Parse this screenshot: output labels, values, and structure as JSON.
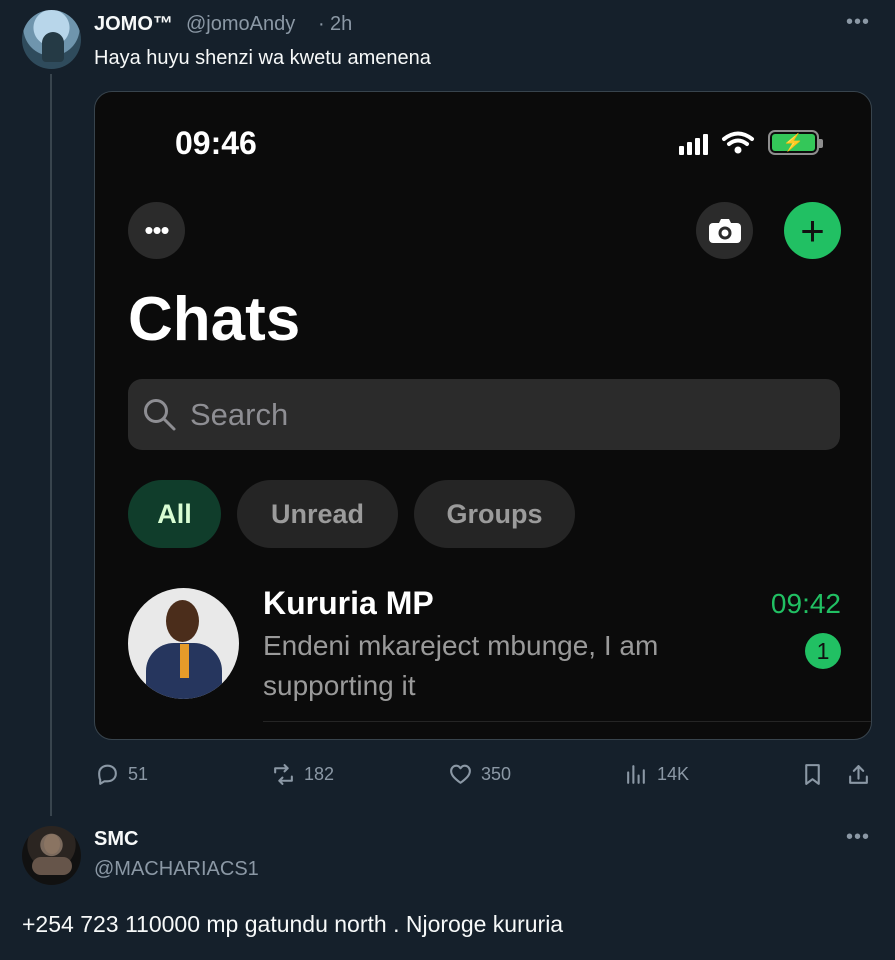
{
  "tweet1": {
    "name": "JOMO™",
    "handle": "@jomoAndy",
    "time": "2h",
    "text": "Haya huyu shenzi wa kwetu amenena",
    "avatar_icon": "profile-photo",
    "menu_icon": "more-horizontal-icon"
  },
  "screenshot": {
    "status_time": "09:46",
    "battery_icon": "battery-charging-icon",
    "title": "Chats",
    "search_placeholder": "Search",
    "filters": [
      "All",
      "Unread",
      "Groups"
    ],
    "active_filter": "All",
    "chat": {
      "name": "Kururia MP",
      "preview": "Endeni mkareject mbunge, I am supporting it",
      "time": "09:42",
      "unread_count": "1"
    },
    "colors": {
      "accent": "#21c063",
      "active_chip": "#103d2b",
      "background": "#0b0b0b"
    }
  },
  "actions": {
    "replies": "51",
    "retweets": "182",
    "likes": "350",
    "views": "14K"
  },
  "tweet2": {
    "name": "SMC",
    "handle": "@MACHARIACS1",
    "text": "+254 723 110000 mp gatundu north . Njoroge kururia",
    "avatar_icon": "profile-photo"
  }
}
